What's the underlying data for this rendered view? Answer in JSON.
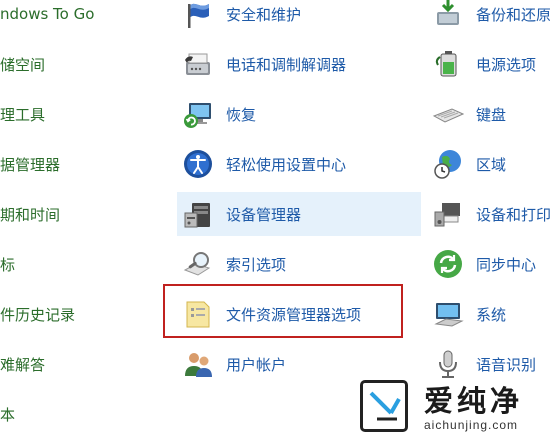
{
  "panel": {
    "col0": [
      "ndows To Go",
      "储空间",
      "理工具",
      "据管理器",
      "期和时间",
      "标",
      "件历史记录",
      "难解答",
      "本"
    ],
    "col1": [
      "安全和维护",
      "电话和调制解调器",
      "恢复",
      "轻松使用设置中心",
      "设备管理器",
      "索引选项",
      "文件资源管理器选项",
      "用户帐户"
    ],
    "col2": [
      "备份和还原",
      "电源选项",
      "键盘",
      "区域",
      "设备和打印",
      "同步中心",
      "系统",
      "语音识别"
    ]
  },
  "watermark": {
    "brand": "爱纯净",
    "url": "aichunjing.com"
  },
  "colors": {
    "link": "#1e5aa8",
    "partial_link": "#2b6d2b",
    "hover_bg": "#e5f1fb",
    "highlight_border": "#c0211f"
  }
}
